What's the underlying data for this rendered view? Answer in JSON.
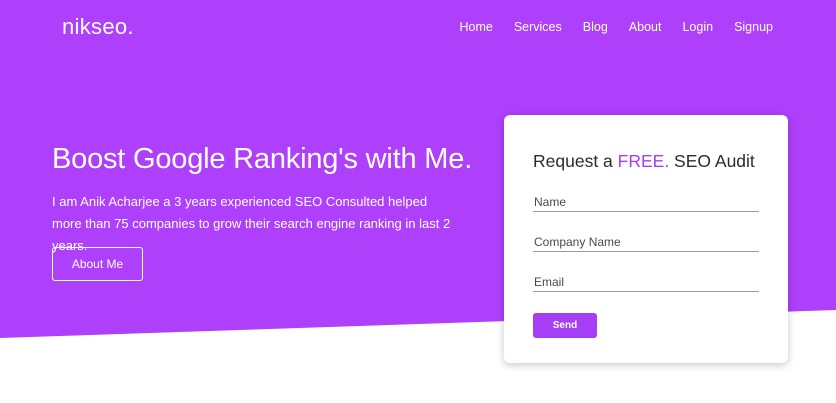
{
  "theme": {
    "brand": "#a63ef7",
    "hero_bg": "#ae3ffa",
    "text_dark": "#2b2b2b"
  },
  "header": {
    "logo": "nikseo.",
    "nav": [
      "Home",
      "Services",
      "Blog",
      "About",
      "Login",
      "Signup"
    ]
  },
  "hero": {
    "title": "Boost Google Ranking's with Me.",
    "intro": "I am Anik Acharjee a 3 years experienced SEO Consulted helped more than 75 companies to grow their search engine ranking in last 2 years.",
    "button": "About Me"
  },
  "audit_form": {
    "title_prefix": "Request a ",
    "title_highlight": "FREE.",
    "title_suffix": " SEO Audit",
    "fields": [
      "Name",
      "Company Name",
      "Email"
    ],
    "submit": "Send"
  }
}
